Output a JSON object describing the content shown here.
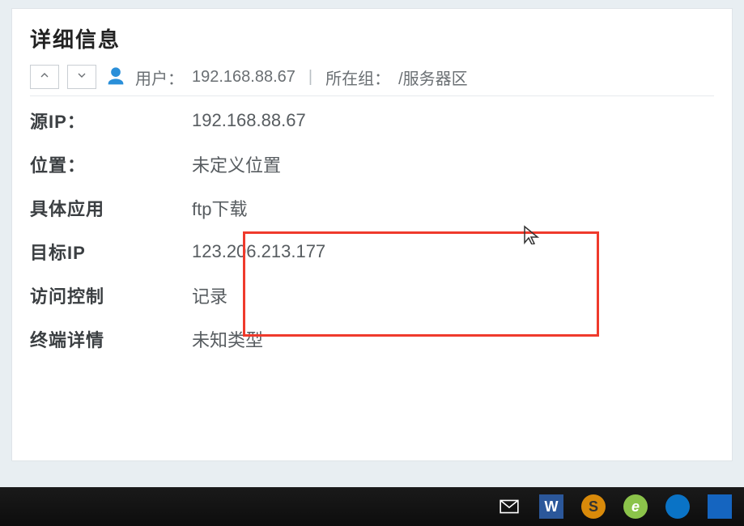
{
  "title": "详细信息",
  "nav": {
    "prev_label": "上一条",
    "next_label": "下一条"
  },
  "header": {
    "user_label": "用户：",
    "user_value": "192.168.88.67",
    "group_label": "所在组：",
    "group_value": "/服务器区",
    "separator": "|"
  },
  "fields": {
    "source_ip": {
      "label": "源IP：",
      "value": "192.168.88.67"
    },
    "location": {
      "label": "位置：",
      "value": "未定义位置"
    },
    "application": {
      "label": "具体应用",
      "value": "ftp下载"
    },
    "target_ip": {
      "label": "目标IP",
      "value": "123.206.213.177"
    },
    "access_control": {
      "label": "访问控制",
      "value": "记录"
    },
    "terminal_detail": {
      "label": "终端详情",
      "value": "未知类型"
    }
  },
  "taskbar_icons": {
    "mail": "mail-icon",
    "word": "W",
    "sublime": "S",
    "ie": "e",
    "app_blue": "app",
    "manager": "manager"
  }
}
